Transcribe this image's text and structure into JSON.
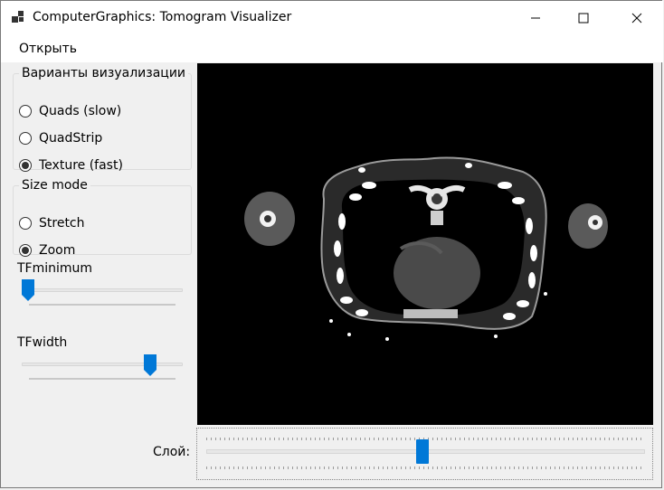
{
  "window": {
    "title": "ComputerGraphics: Tomogram Visualizer",
    "controls": [
      "minimize",
      "maximize",
      "close"
    ]
  },
  "menu": {
    "open_label": "Открыть"
  },
  "visualization_group": {
    "legend": "Варианты визуализации",
    "options": [
      {
        "label": "Quads (slow)",
        "checked": false
      },
      {
        "label": "QuadStrip",
        "checked": false
      },
      {
        "label": "Texture (fast)",
        "checked": true
      }
    ]
  },
  "size_mode_group": {
    "legend": "Size mode",
    "options": [
      {
        "label": "Stretch",
        "checked": false
      },
      {
        "label": "Zoom",
        "checked": true
      }
    ]
  },
  "tf_minimum": {
    "label": "TFminimum",
    "level": 0.0
  },
  "tf_width": {
    "label": "TFwidth",
    "level": 0.83
  },
  "layer": {
    "label": "Слой:",
    "level": 0.49
  },
  "colors": {
    "accent": "#0078d7",
    "viewport_bg": "#000000",
    "window_bg": "#f0f0f0"
  },
  "icons": {
    "app": "app-icon",
    "minimize": "minimize-icon",
    "maximize": "maximize-icon",
    "close": "close-icon"
  }
}
